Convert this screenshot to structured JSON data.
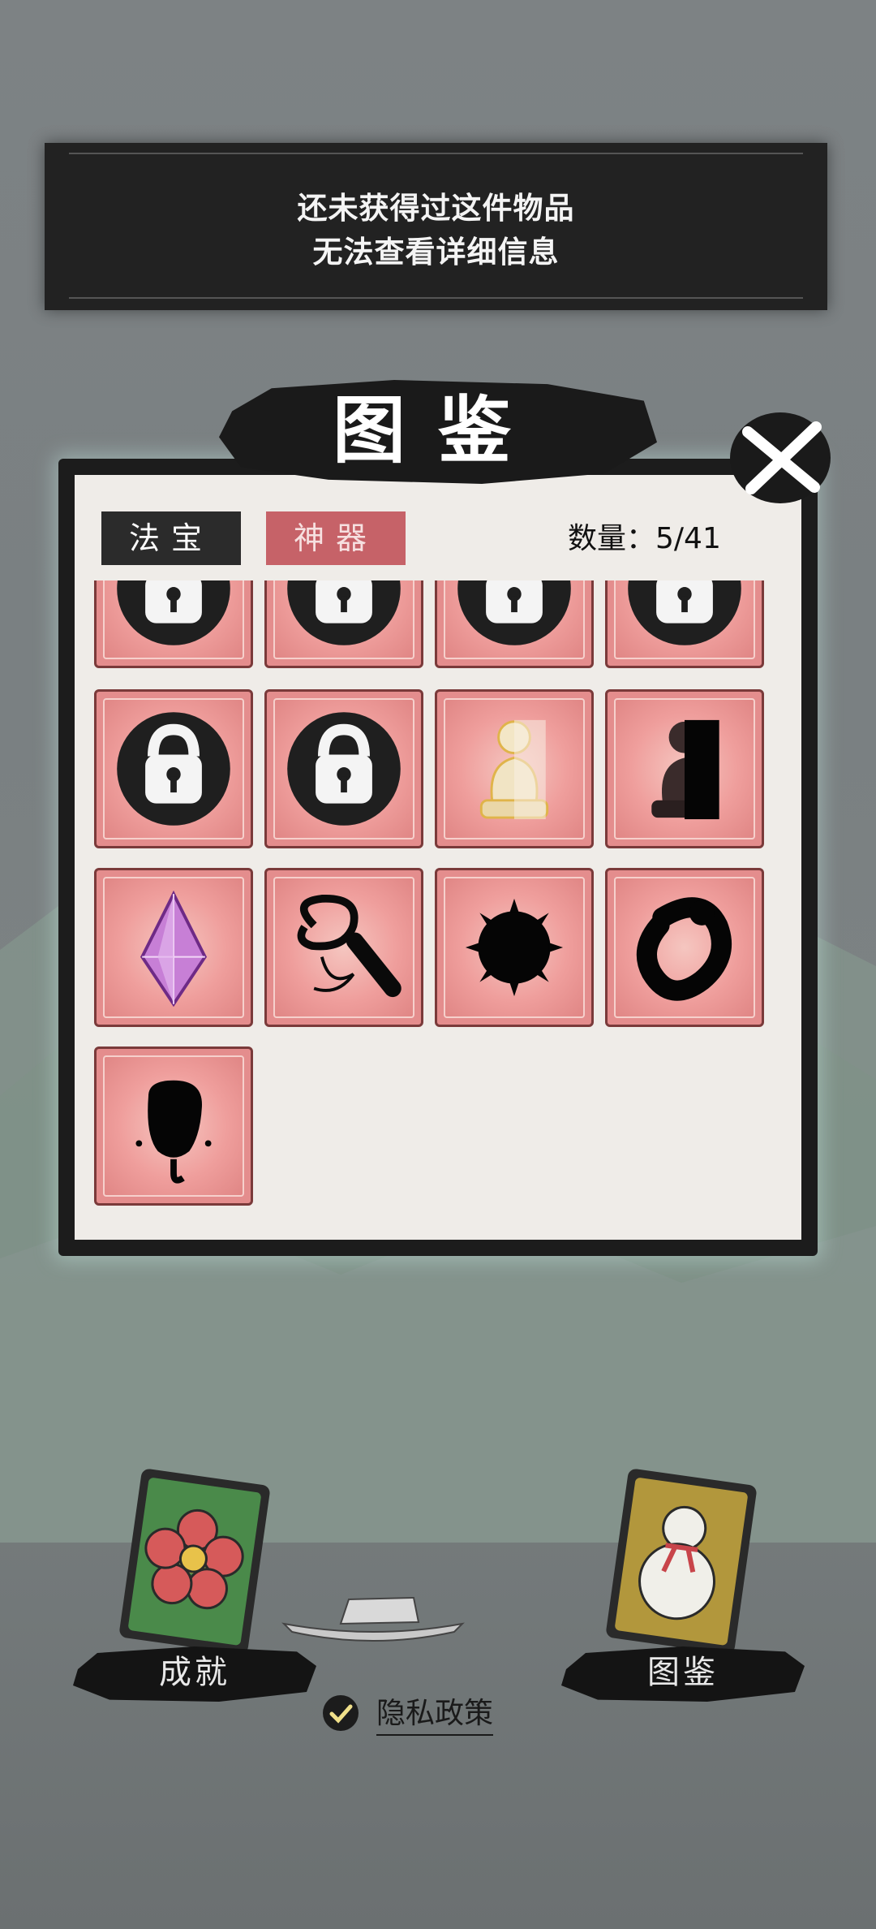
{
  "toast": {
    "line1": "还未获得过这件物品",
    "line2": "无法查看详细信息"
  },
  "panel": {
    "title": "图鉴",
    "tabs": [
      {
        "label": "法宝"
      },
      {
        "label": "神器"
      }
    ],
    "count_text": "数量：5/41",
    "close_icon": "close-x-icon"
  },
  "items": [
    {
      "icon": "lock-icon",
      "locked": true
    },
    {
      "icon": "lock-icon",
      "locked": true
    },
    {
      "icon": "lock-icon",
      "locked": true
    },
    {
      "icon": "lock-icon",
      "locked": true
    },
    {
      "icon": "lock-icon",
      "locked": true
    },
    {
      "icon": "lock-icon",
      "locked": true
    },
    {
      "icon": "buddha-statue-icon",
      "locked": false
    },
    {
      "icon": "dark-statue-icon",
      "locked": false
    },
    {
      "icon": "purple-crystal-icon",
      "locked": false
    },
    {
      "icon": "whip-silhouette-icon",
      "locked": false
    },
    {
      "icon": "spiked-orb-silhouette-icon",
      "locked": false
    },
    {
      "icon": "ring-silhouette-icon",
      "locked": false
    },
    {
      "icon": "fan-silhouette-icon",
      "locked": false
    }
  ],
  "bottom": {
    "achievements_label": "成就",
    "codex_label": "图鉴",
    "privacy_label": "隐私政策"
  },
  "colors": {
    "cell_fill": "#e48d8d",
    "tab_active": "#c66268",
    "panel_bg": "#efece8"
  }
}
